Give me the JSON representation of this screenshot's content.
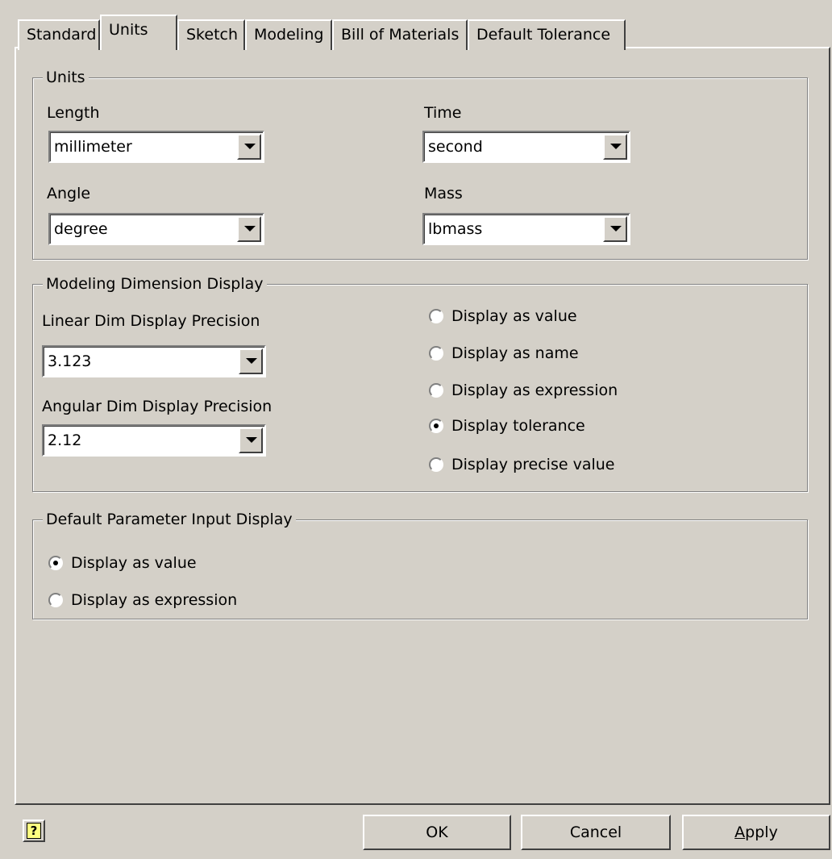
{
  "tabs": [
    "Standard",
    "Units",
    "Sketch",
    "Modeling",
    "Bill of Materials",
    "Default Tolerance"
  ],
  "units_group": {
    "title": "Units",
    "length_label": "Length",
    "length_value": "millimeter",
    "time_label": "Time",
    "time_value": "second",
    "angle_label": "Angle",
    "angle_value": "degree",
    "mass_label": "Mass",
    "mass_value": "lbmass"
  },
  "modeling_group": {
    "title": "Modeling Dimension Display",
    "linear_label": "Linear Dim Display Precision",
    "linear_value": "3.123",
    "angular_label": "Angular Dim Display Precision",
    "angular_value": "2.12",
    "options": [
      {
        "label": "Display as value",
        "checked": false
      },
      {
        "label": "Display as name",
        "checked": false
      },
      {
        "label": "Display as expression",
        "checked": false
      },
      {
        "label": "Display tolerance",
        "checked": true
      },
      {
        "label": "Display precise value",
        "checked": false
      }
    ]
  },
  "param_group": {
    "title": "Default Parameter Input Display",
    "options": [
      {
        "label": "Display as value",
        "checked": true
      },
      {
        "label": "Display as expression",
        "checked": false
      }
    ]
  },
  "buttons": {
    "help_glyph": "?",
    "ok": "OK",
    "cancel": "Cancel",
    "apply_first": "A",
    "apply_rest": "pply"
  }
}
